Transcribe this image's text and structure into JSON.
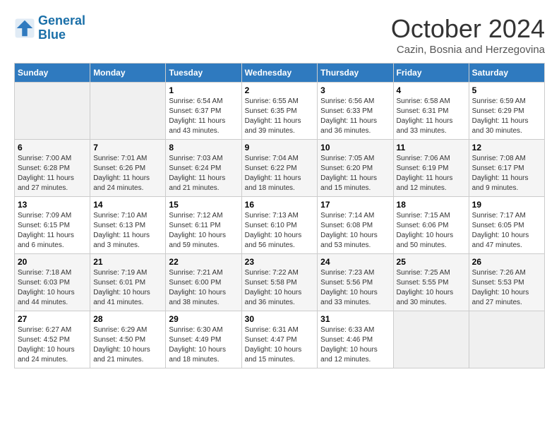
{
  "header": {
    "logo_line1": "General",
    "logo_line2": "Blue",
    "month": "October 2024",
    "location": "Cazin, Bosnia and Herzegovina"
  },
  "columns": [
    "Sunday",
    "Monday",
    "Tuesday",
    "Wednesday",
    "Thursday",
    "Friday",
    "Saturday"
  ],
  "weeks": [
    [
      {
        "day": "",
        "info": ""
      },
      {
        "day": "",
        "info": ""
      },
      {
        "day": "1",
        "info": "Sunrise: 6:54 AM\nSunset: 6:37 PM\nDaylight: 11 hours and 43 minutes."
      },
      {
        "day": "2",
        "info": "Sunrise: 6:55 AM\nSunset: 6:35 PM\nDaylight: 11 hours and 39 minutes."
      },
      {
        "day": "3",
        "info": "Sunrise: 6:56 AM\nSunset: 6:33 PM\nDaylight: 11 hours and 36 minutes."
      },
      {
        "day": "4",
        "info": "Sunrise: 6:58 AM\nSunset: 6:31 PM\nDaylight: 11 hours and 33 minutes."
      },
      {
        "day": "5",
        "info": "Sunrise: 6:59 AM\nSunset: 6:29 PM\nDaylight: 11 hours and 30 minutes."
      }
    ],
    [
      {
        "day": "6",
        "info": "Sunrise: 7:00 AM\nSunset: 6:28 PM\nDaylight: 11 hours and 27 minutes."
      },
      {
        "day": "7",
        "info": "Sunrise: 7:01 AM\nSunset: 6:26 PM\nDaylight: 11 hours and 24 minutes."
      },
      {
        "day": "8",
        "info": "Sunrise: 7:03 AM\nSunset: 6:24 PM\nDaylight: 11 hours and 21 minutes."
      },
      {
        "day": "9",
        "info": "Sunrise: 7:04 AM\nSunset: 6:22 PM\nDaylight: 11 hours and 18 minutes."
      },
      {
        "day": "10",
        "info": "Sunrise: 7:05 AM\nSunset: 6:20 PM\nDaylight: 11 hours and 15 minutes."
      },
      {
        "day": "11",
        "info": "Sunrise: 7:06 AM\nSunset: 6:19 PM\nDaylight: 11 hours and 12 minutes."
      },
      {
        "day": "12",
        "info": "Sunrise: 7:08 AM\nSunset: 6:17 PM\nDaylight: 11 hours and 9 minutes."
      }
    ],
    [
      {
        "day": "13",
        "info": "Sunrise: 7:09 AM\nSunset: 6:15 PM\nDaylight: 11 hours and 6 minutes."
      },
      {
        "day": "14",
        "info": "Sunrise: 7:10 AM\nSunset: 6:13 PM\nDaylight: 11 hours and 3 minutes."
      },
      {
        "day": "15",
        "info": "Sunrise: 7:12 AM\nSunset: 6:11 PM\nDaylight: 10 hours and 59 minutes."
      },
      {
        "day": "16",
        "info": "Sunrise: 7:13 AM\nSunset: 6:10 PM\nDaylight: 10 hours and 56 minutes."
      },
      {
        "day": "17",
        "info": "Sunrise: 7:14 AM\nSunset: 6:08 PM\nDaylight: 10 hours and 53 minutes."
      },
      {
        "day": "18",
        "info": "Sunrise: 7:15 AM\nSunset: 6:06 PM\nDaylight: 10 hours and 50 minutes."
      },
      {
        "day": "19",
        "info": "Sunrise: 7:17 AM\nSunset: 6:05 PM\nDaylight: 10 hours and 47 minutes."
      }
    ],
    [
      {
        "day": "20",
        "info": "Sunrise: 7:18 AM\nSunset: 6:03 PM\nDaylight: 10 hours and 44 minutes."
      },
      {
        "day": "21",
        "info": "Sunrise: 7:19 AM\nSunset: 6:01 PM\nDaylight: 10 hours and 41 minutes."
      },
      {
        "day": "22",
        "info": "Sunrise: 7:21 AM\nSunset: 6:00 PM\nDaylight: 10 hours and 38 minutes."
      },
      {
        "day": "23",
        "info": "Sunrise: 7:22 AM\nSunset: 5:58 PM\nDaylight: 10 hours and 36 minutes."
      },
      {
        "day": "24",
        "info": "Sunrise: 7:23 AM\nSunset: 5:56 PM\nDaylight: 10 hours and 33 minutes."
      },
      {
        "day": "25",
        "info": "Sunrise: 7:25 AM\nSunset: 5:55 PM\nDaylight: 10 hours and 30 minutes."
      },
      {
        "day": "26",
        "info": "Sunrise: 7:26 AM\nSunset: 5:53 PM\nDaylight: 10 hours and 27 minutes."
      }
    ],
    [
      {
        "day": "27",
        "info": "Sunrise: 6:27 AM\nSunset: 4:52 PM\nDaylight: 10 hours and 24 minutes."
      },
      {
        "day": "28",
        "info": "Sunrise: 6:29 AM\nSunset: 4:50 PM\nDaylight: 10 hours and 21 minutes."
      },
      {
        "day": "29",
        "info": "Sunrise: 6:30 AM\nSunset: 4:49 PM\nDaylight: 10 hours and 18 minutes."
      },
      {
        "day": "30",
        "info": "Sunrise: 6:31 AM\nSunset: 4:47 PM\nDaylight: 10 hours and 15 minutes."
      },
      {
        "day": "31",
        "info": "Sunrise: 6:33 AM\nSunset: 4:46 PM\nDaylight: 10 hours and 12 minutes."
      },
      {
        "day": "",
        "info": ""
      },
      {
        "day": "",
        "info": ""
      }
    ]
  ]
}
